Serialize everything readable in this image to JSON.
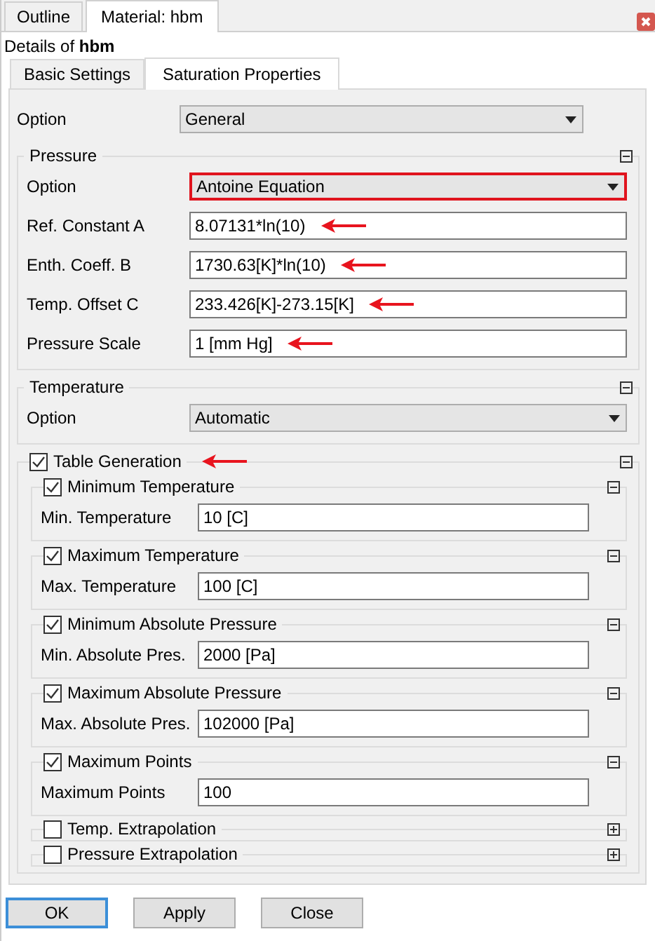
{
  "window_tabs": [
    {
      "label": "Outline",
      "selected": false
    },
    {
      "label": "Material: hbm",
      "selected": true
    }
  ],
  "details_title": "Details of **hbm**",
  "tabs": [
    {
      "label": "Basic Settings",
      "selected": false
    },
    {
      "label": "Saturation Properties",
      "selected": true
    }
  ],
  "option": {
    "label": "Option",
    "value": "General"
  },
  "groups": [
    {
      "title": "Pressure",
      "kind": "plain",
      "expanded": true,
      "annotated": false,
      "rows": [
        {
          "label": "Option",
          "kind": "dropdown",
          "value": "Antoine Equation",
          "highlighted": true,
          "annotated": false
        },
        {
          "label": "Ref. Constant A",
          "kind": "text",
          "value": "8.07131*ln(10)",
          "annotated": true
        },
        {
          "label": "Enth. Coeff. B",
          "kind": "text",
          "value": "1730.63[K]*ln(10)",
          "annotated": true
        },
        {
          "label": "Temp. Offset C",
          "kind": "text",
          "value": "233.426[K]-273.15[K]",
          "annotated": true
        },
        {
          "label": "Pressure Scale",
          "kind": "text",
          "value": "1 [mm Hg]",
          "annotated": true
        }
      ]
    },
    {
      "title": "Temperature",
      "kind": "plain",
      "expanded": true,
      "annotated": false,
      "rows": [
        {
          "label": "Option",
          "kind": "dropdown",
          "value": "Automatic",
          "highlighted": false,
          "annotated": false
        }
      ]
    },
    {
      "title": "Table Generation",
      "kind": "checkable",
      "checked": true,
      "expanded": true,
      "annotated": true,
      "subgroups": [
        {
          "title": "Minimum Temperature",
          "checked": true,
          "expanded": true,
          "rows": [
            {
              "label": "Min. Temperature",
              "kind": "text",
              "value": "10 [C]",
              "annotated": false
            }
          ]
        },
        {
          "title": "Maximum Temperature",
          "checked": true,
          "expanded": true,
          "rows": [
            {
              "label": "Max. Temperature",
              "kind": "text",
              "value": "100 [C]",
              "annotated": false
            }
          ]
        },
        {
          "title": "Minimum Absolute Pressure",
          "checked": true,
          "expanded": true,
          "rows": [
            {
              "label": "Min. Absolute Pres.",
              "kind": "text",
              "value": "2000 [Pa]",
              "annotated": false
            }
          ]
        },
        {
          "title": "Maximum Absolute Pressure",
          "checked": true,
          "expanded": true,
          "rows": [
            {
              "label": "Max. Absolute Pres.",
              "kind": "text",
              "value": "102000 [Pa]",
              "annotated": false
            }
          ]
        },
        {
          "title": "Maximum Points",
          "checked": true,
          "expanded": true,
          "rows": [
            {
              "label": "Maximum Points",
              "kind": "text",
              "value": "100",
              "annotated": false
            }
          ]
        },
        {
          "title": "Temp. Extrapolation",
          "checked": false,
          "expanded": false
        },
        {
          "title": "Pressure Extrapolation",
          "checked": false,
          "expanded": false
        }
      ]
    }
  ],
  "buttons": [
    {
      "label": "OK",
      "focused": true
    },
    {
      "label": "Apply",
      "focused": false
    },
    {
      "label": "Close",
      "focused": false
    }
  ]
}
